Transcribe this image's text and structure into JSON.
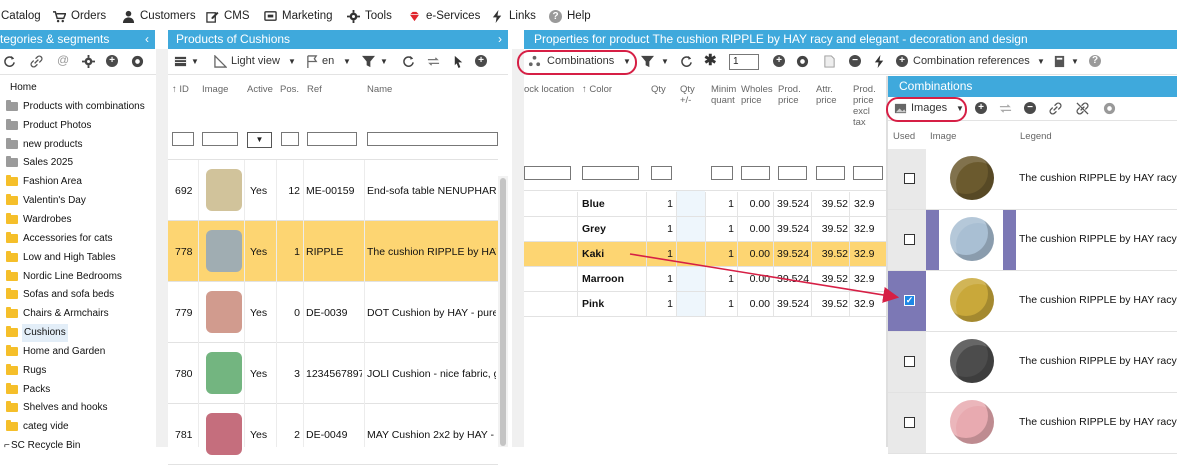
{
  "topmenu": {
    "catalog": "Catalog",
    "orders": "Orders",
    "customers": "Customers",
    "cms": "CMS",
    "marketing": "Marketing",
    "tools": "Tools",
    "eservices": "e-Services",
    "links": "Links",
    "help": "Help"
  },
  "categories": {
    "header": "tegories & segments",
    "items": [
      {
        "label": "Home"
      },
      {
        "label": "Products with combinations"
      },
      {
        "label": "Product Photos"
      },
      {
        "label": "new products"
      },
      {
        "label": "Sales 2025"
      },
      {
        "label": "Fashion Area"
      },
      {
        "label": "Valentin's Day"
      },
      {
        "label": "Wardrobes"
      },
      {
        "label": "Accessories for cats"
      },
      {
        "label": "Low and High Tables"
      },
      {
        "label": "Nordic Line Bedrooms"
      },
      {
        "label": "Sofas and sofa beds"
      },
      {
        "label": "Chairs & Armchairs"
      },
      {
        "label": "Cushions"
      },
      {
        "label": "Home and Garden"
      },
      {
        "label": "Rugs"
      },
      {
        "label": "Packs"
      },
      {
        "label": "Shelves and hooks"
      },
      {
        "label": "categ vide"
      },
      {
        "label": "SC Recycle Bin"
      }
    ]
  },
  "products": {
    "header": "Products of Cushions",
    "toolbar": {
      "view": "Light view",
      "lang": "en"
    },
    "columns": {
      "id": "ID",
      "image": "Image",
      "active": "Active",
      "pos": "Pos.",
      "ref": "Ref",
      "name": "Name"
    },
    "rows": [
      {
        "id": "692",
        "active": "Yes",
        "pos": "12",
        "ref": "ME-00159",
        "name": "End-sofa table NENUPHAR"
      },
      {
        "id": "778",
        "active": "Yes",
        "pos": "1",
        "ref": "RIPPLE",
        "name": "The cushion RIPPLE by HAY"
      },
      {
        "id": "779",
        "active": "Yes",
        "pos": "0",
        "ref": "DE-0039",
        "name": "DOT Cushion by HAY - pure"
      },
      {
        "id": "780",
        "active": "Yes",
        "pos": "3",
        "ref": "1234567897",
        "name": "JOLI Cushion - nice fabric, g"
      },
      {
        "id": "781",
        "active": "Yes",
        "pos": "2",
        "ref": "DE-0049",
        "name": "MAY Cushion 2x2 by HAY -"
      }
    ]
  },
  "properties": {
    "header": "Properties for product The cushion RIPPLE by HAY racy and elegant - decoration and design",
    "toolbar": {
      "combinations": "Combinations",
      "qty": "1",
      "refs": "Combination references"
    },
    "columns": {
      "lock": "ock location",
      "color": "Color",
      "qty": "Qty",
      "qtyd": "Qty +/-",
      "minq": "Minim quant",
      "wp": "Wholes price",
      "pp": "Prod. price",
      "ap": "Attr. price",
      "ppx": "Prod. price excl tax"
    },
    "rows": [
      {
        "color": "Blue",
        "qty": "1",
        "minq": "1",
        "wp": "0.00",
        "pp": "39.524",
        "ap": "39.52",
        "ppx": "32.9"
      },
      {
        "color": "Grey",
        "qty": "1",
        "minq": "1",
        "wp": "0.00",
        "pp": "39.524",
        "ap": "39.52",
        "ppx": "32.9"
      },
      {
        "color": "Kaki",
        "qty": "1",
        "minq": "1",
        "wp": "0.00",
        "pp": "39.524",
        "ap": "39.52",
        "ppx": "32.9"
      },
      {
        "color": "Marroon",
        "qty": "1",
        "minq": "1",
        "wp": "0.00",
        "pp": "39.524",
        "ap": "39.52",
        "ppx": "32.9"
      },
      {
        "color": "Pink",
        "qty": "1",
        "minq": "1",
        "wp": "0.00",
        "pp": "39.524",
        "ap": "39.52",
        "ppx": "32.9"
      }
    ]
  },
  "combos": {
    "header": "Combinations",
    "toolbar": {
      "images": "Images"
    },
    "columns": {
      "used": "Used",
      "image": "Image",
      "legend": "Legend"
    },
    "rows": [
      {
        "legend": "The cushion RIPPLE by HAY racy",
        "checked": false,
        "color": "#6b5a2e"
      },
      {
        "legend": "The cushion RIPPLE by HAY racy",
        "checked": false,
        "color": "#a9bfd3"
      },
      {
        "legend": "The cushion RIPPLE by HAY racy",
        "checked": true,
        "color": "#c9a83a"
      },
      {
        "legend": "The cushion RIPPLE by HAY racy",
        "checked": false,
        "color": "#4c4c4c"
      },
      {
        "legend": "The cushion RIPPLE by HAY racy",
        "checked": false,
        "color": "#e8aab0"
      }
    ]
  }
}
